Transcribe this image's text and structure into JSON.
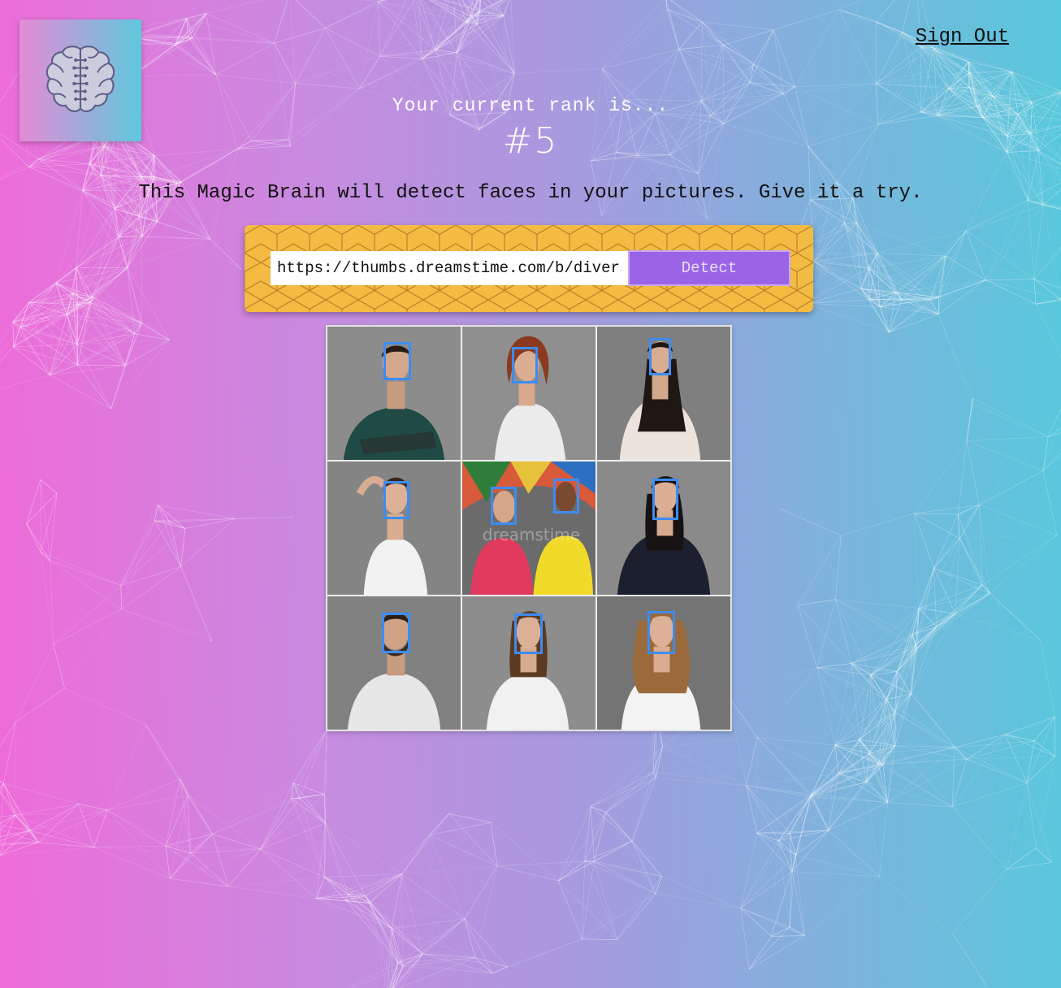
{
  "header": {
    "logo_icon": "brain-icon",
    "sign_out_label": "Sign Out"
  },
  "rank": {
    "label": "Your current rank is...",
    "value": "#5"
  },
  "tagline": "This Magic Brain will detect faces in your pictures. Give it a try.",
  "form": {
    "url_value": "https://thumbs.dreamstime.com/b/diverse-people-thinking-collage",
    "detect_label": "Detect"
  },
  "image": {
    "watermark": "dreamstime",
    "faces_detected": 10
  },
  "colors": {
    "gradient_left": "#ee6bd9",
    "gradient_right": "#58c8dc",
    "panel": "#f4bb43",
    "button": "#9b64e6",
    "bounding_box": "#3d8cf2"
  }
}
